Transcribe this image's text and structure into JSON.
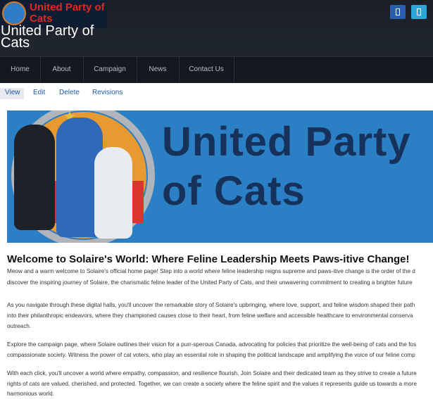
{
  "header": {
    "logo_text": "United Party of Cats",
    "site_name": "United Party of Cats"
  },
  "social": {
    "icons": [
      "facebook-icon",
      "twitter-icon"
    ]
  },
  "nav": {
    "items": [
      "Home",
      "About",
      "Campaign",
      "News",
      "Contact Us"
    ]
  },
  "tabs": {
    "items": [
      "View",
      "Edit",
      "Delete",
      "Revisions"
    ],
    "active": "View"
  },
  "banner": {
    "title": "United Party of Cats"
  },
  "content": {
    "headline": "Welcome to Solaire's World: Where Feline Leadership Meets Paws-itive Change!",
    "paragraphs": [
      "Meow and a warm welcome to Solaire's official home page! Step into a world where feline leadership reigns supreme and paws-itive change is the order of the d",
      "discover the inspiring journey of Solaire, the charismatic feline leader of the United Party of Cats, and their unwavering commitment to creating a brighter future",
      "As you navigate through these digital halls, you'll uncover the remarkable story of Solaire's upbringing, where love, support, and feline wisdom shaped their path",
      "into their philanthropic endeavors, where they championed causes close to their heart, from feline welfare and accessible healthcare to environmental conserva",
      "outreach.",
      "Explore the campaign page, where Solaire outlines their vision for a purr-sperous Canada, advocating for policies that prioritize the well-being of cats and the fos",
      "compassionate society. Witness the power of cat voters, who play an essential role in shaping the political landscape and amplifying the voice of our feline comp",
      "With each click, you'll uncover a world where empathy, compassion, and resilience flourish. Join Solaire and their dedicated team as they strive to create a future",
      "rights of cats are valued, cherished, and protected. Together, we can create a society where the feline spirit and the values it represents guide us towards a more",
      "harmonious world."
    ]
  },
  "colors": {
    "header_bg": "#1a1f26",
    "logo_red": "#e0291e",
    "link_blue": "#1c5aa5",
    "banner_blue": "#2b7fc5",
    "banner_title": "#17325a"
  }
}
